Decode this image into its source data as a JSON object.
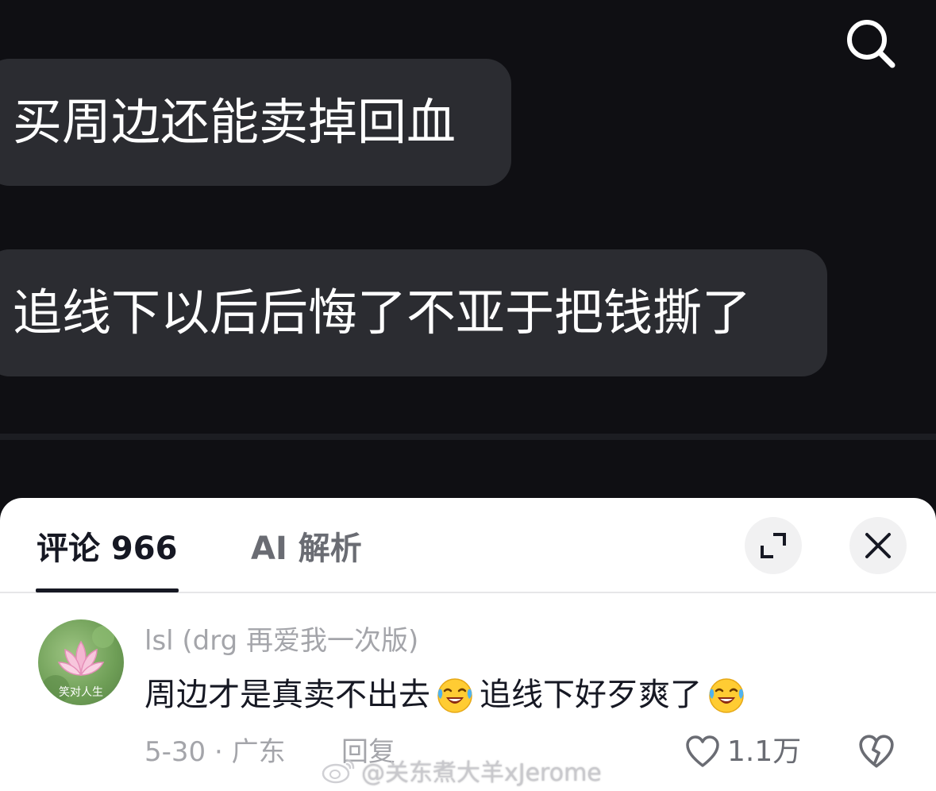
{
  "video": {
    "messages": [
      "买周边还能卖掉回血",
      "追线下以后后悔了不亚于把钱撕了"
    ]
  },
  "comments_panel": {
    "tabs": [
      {
        "label": "评论 966",
        "selected": true
      },
      {
        "label": "AI 解析",
        "selected": false
      }
    ]
  },
  "comment": {
    "avatar_text": "笑对人生",
    "username": "lsl (drg 再爱我一次版)",
    "text_part1": "周边才是真卖不出去",
    "text_part2": "追线下好歹爽了",
    "date_location": "5-30 · 广东",
    "reply_label": "回复",
    "like_count": "1.1万"
  },
  "watermark": "@关东煮大羊xJerome",
  "icons": {
    "search": "search-icon",
    "expand": "expand-icon",
    "close": "close-icon",
    "emoji": "laughing-crying-emoji",
    "like": "heart-icon",
    "dislike": "broken-heart-icon",
    "weibo": "weibo-logo"
  },
  "colors": {
    "background": "#0f0f13",
    "bubble": "#2b2c31",
    "sheet": "#ffffff",
    "primary_text": "#161823",
    "secondary_text": "#a4a5aa"
  }
}
